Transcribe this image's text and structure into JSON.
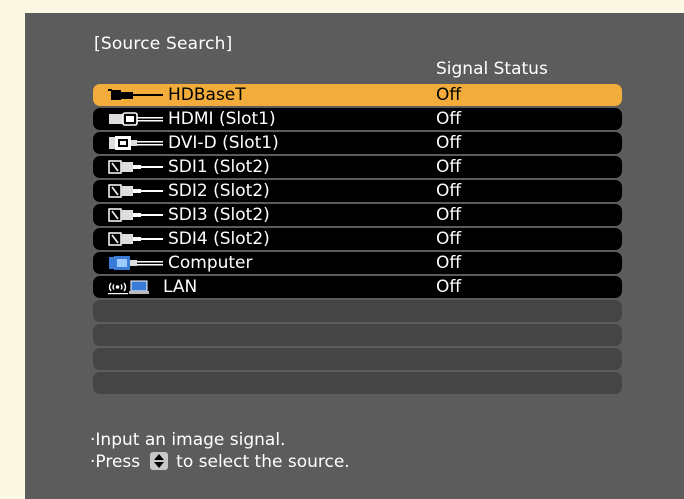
{
  "dialog": {
    "title": "[Source Search]",
    "status_header": "Signal Status"
  },
  "sources": [
    {
      "name": "HDBaseT",
      "status": "Off",
      "icon": "hdbaset-icon",
      "selected": true
    },
    {
      "name": "HDMI (Slot1)",
      "status": "Off",
      "icon": "hdmi-icon",
      "selected": false
    },
    {
      "name": "DVI-D (Slot1)",
      "status": "Off",
      "icon": "dvi-icon",
      "selected": false
    },
    {
      "name": "SDI1 (Slot2)",
      "status": "Off",
      "icon": "sdi-icon",
      "selected": false
    },
    {
      "name": "SDI2 (Slot2)",
      "status": "Off",
      "icon": "sdi-icon",
      "selected": false
    },
    {
      "name": "SDI3 (Slot2)",
      "status": "Off",
      "icon": "sdi-icon",
      "selected": false
    },
    {
      "name": "SDI4 (Slot2)",
      "status": "Off",
      "icon": "sdi-icon",
      "selected": false
    },
    {
      "name": "Computer",
      "status": "Off",
      "icon": "computer-icon",
      "selected": false
    },
    {
      "name": "LAN",
      "status": "Off",
      "icon": "lan-icon",
      "selected": false
    }
  ],
  "help": {
    "line1": "·Input an image signal.",
    "line2_prefix": "·Press",
    "line2_icon": "up-down-arrow-icon",
    "line2_suffix": "to select the source."
  },
  "colors": {
    "background": "#5c5c5c",
    "selected_row": "#f2ac3c",
    "row": "#000000",
    "empty_row": "#454545"
  }
}
